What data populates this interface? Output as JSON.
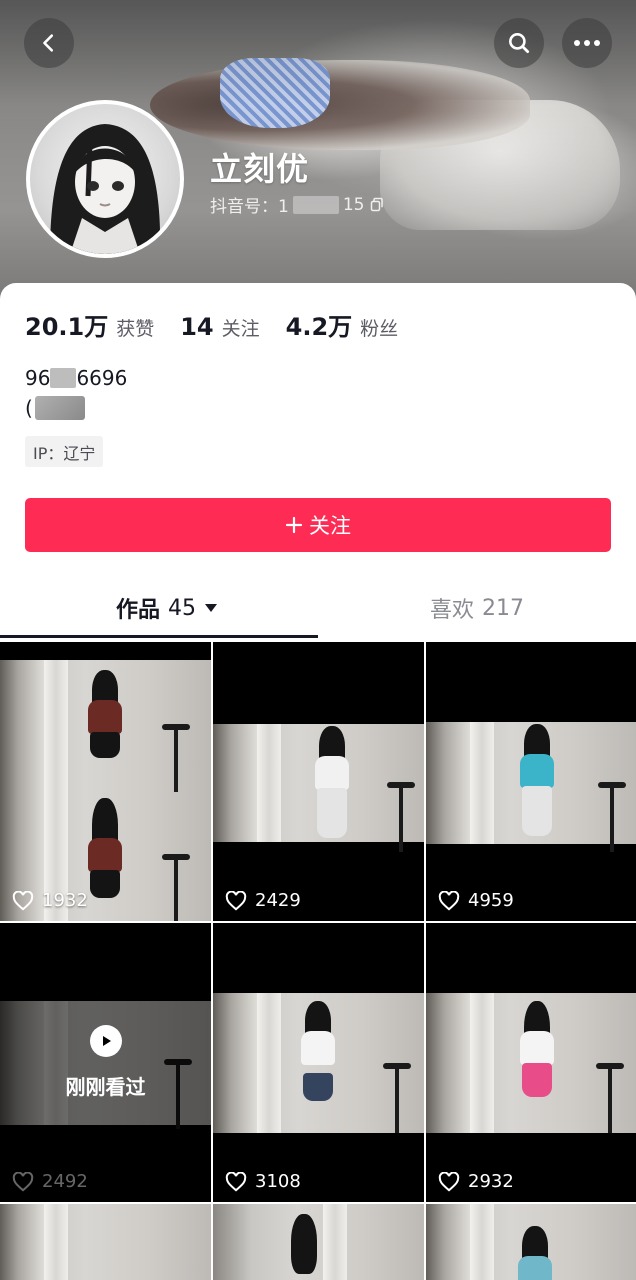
{
  "profile": {
    "username": "立刻优",
    "douyin_id_prefix": "抖音号：1",
    "douyin_id_suffix": "15",
    "copy_icon": "copy-icon"
  },
  "stats": [
    {
      "num": "20.1万",
      "label": "获赞"
    },
    {
      "num": "14",
      "label": "关注"
    },
    {
      "num": "4.2万",
      "label": "粉丝"
    }
  ],
  "bio": {
    "line1_prefix": "96",
    "line1_suffix": "6696",
    "line2": "("
  },
  "ip_tag": "IP：辽宁",
  "follow_button": {
    "label": "关注",
    "icon": "plus-icon"
  },
  "tabs": {
    "works": {
      "label": "作品",
      "count": "45"
    },
    "likes": {
      "label": "喜欢",
      "count": "217"
    }
  },
  "videos": [
    {
      "likes": "1932"
    },
    {
      "likes": "2429"
    },
    {
      "likes": "4959"
    },
    {
      "likes": "2492",
      "overlay": "刚刚看过"
    },
    {
      "likes": "3108"
    },
    {
      "likes": "2932"
    },
    {
      "likes": ""
    },
    {
      "likes": ""
    },
    {
      "likes": ""
    }
  ],
  "colors": {
    "accent": "#fe2c55",
    "text_primary": "#161823",
    "text_secondary": "#8a8b91"
  }
}
